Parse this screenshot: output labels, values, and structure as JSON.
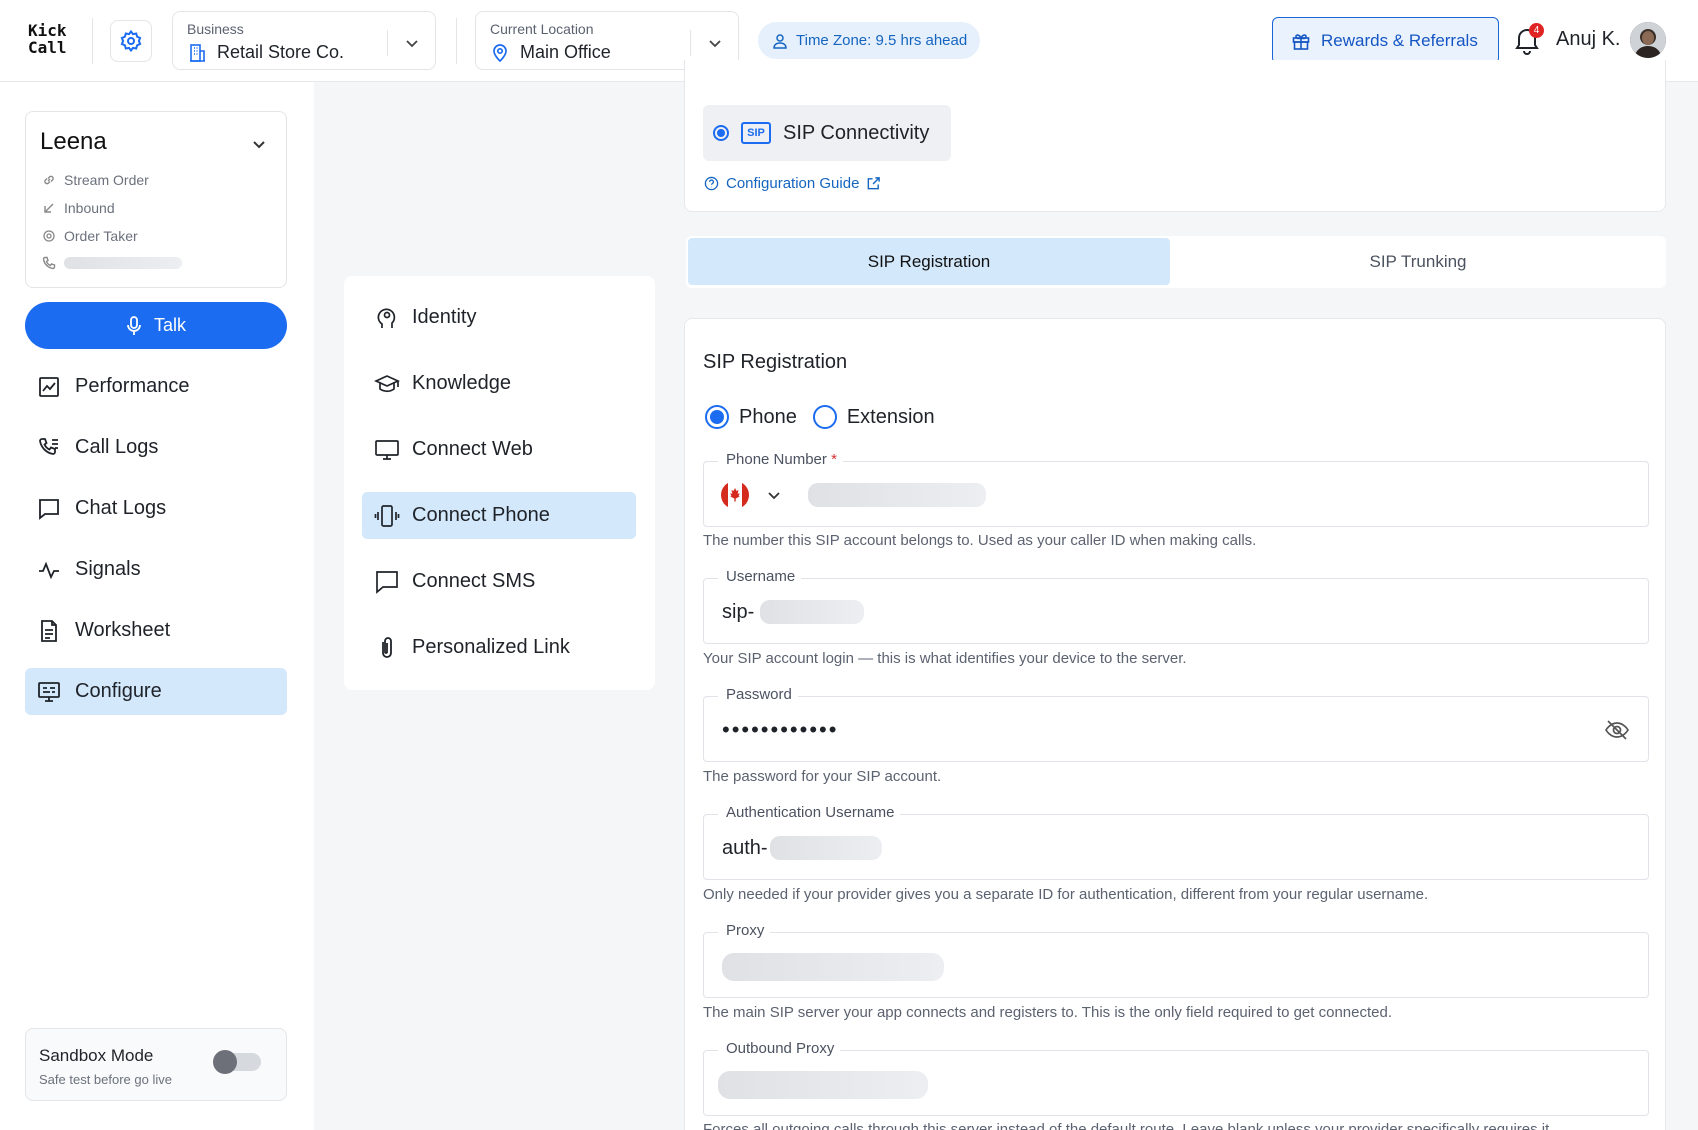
{
  "header": {
    "logo_line1": "Kick",
    "logo_line2": "Call",
    "business_label": "Business",
    "business_value": "Retail Store Co.",
    "location_label": "Current Location",
    "location_value": "Main Office",
    "timezone": "Time Zone: 9.5 hrs ahead",
    "rewards_label": "Rewards & Referrals",
    "notification_count": "4",
    "user_name": "Anuj K."
  },
  "sidebar": {
    "agent_name": "Leena",
    "agent_meta": [
      "Stream Order",
      "Inbound",
      "Order Taker"
    ],
    "talk_label": "Talk",
    "items": [
      {
        "label": "Performance",
        "icon": "chart-icon"
      },
      {
        "label": "Call Logs",
        "icon": "phone-log-icon"
      },
      {
        "label": "Chat Logs",
        "icon": "chat-icon"
      },
      {
        "label": "Signals",
        "icon": "signal-icon"
      },
      {
        "label": "Worksheet",
        "icon": "document-icon"
      },
      {
        "label": "Configure",
        "icon": "monitor-config-icon",
        "active": true
      }
    ],
    "sandbox_title": "Sandbox Mode",
    "sandbox_subtitle": "Safe test before go live",
    "sandbox_enabled": false
  },
  "config_nav": {
    "items": [
      {
        "label": "Identity",
        "icon": "head-gear-icon"
      },
      {
        "label": "Knowledge",
        "icon": "graduation-cap-icon"
      },
      {
        "label": "Connect Web",
        "icon": "monitor-icon"
      },
      {
        "label": "Connect Phone",
        "icon": "vibrating-phone-icon",
        "active": true
      },
      {
        "label": "Connect SMS",
        "icon": "message-icon"
      },
      {
        "label": "Personalized Link",
        "icon": "paperclip-icon"
      }
    ]
  },
  "sip": {
    "connectivity_sip_logo": "SIP",
    "connectivity_label": "SIP  Connectivity",
    "guide_label": "Configuration Guide",
    "tabs": [
      "SIP Registration",
      "SIP Trunking"
    ],
    "active_tab": "SIP Registration",
    "form_title": "SIP Registration",
    "mode_options": [
      "Phone",
      "Extension"
    ],
    "mode_selected": "Phone",
    "phone_label": "Phone Number",
    "phone_required": "*",
    "phone_help": "The number this SIP account belongs to. Used as your caller ID when making calls.",
    "username_label": "Username",
    "username_value": "sip-",
    "username_help": "Your SIP account login — this is what identifies your device to the server.",
    "password_label": "Password",
    "password_value": "••••••••••••",
    "password_help": "The password for your SIP account.",
    "auth_label": "Authentication Username",
    "auth_value": "auth-",
    "auth_help": "Only needed if your provider gives you a separate ID for authentication, different from your regular username.",
    "proxy_label": "Proxy",
    "proxy_help": "The main SIP server your app connects and registers to. This is the only field required to get connected.",
    "outbound_label": "Outbound Proxy",
    "outbound_help": "Forces all outgoing calls through this server instead of the default route. Leave blank unless your provider specifically requires it."
  },
  "colors": {
    "accent": "#1b6cf0",
    "active_bg": "#d3e8fb",
    "link": "#1565c0"
  }
}
